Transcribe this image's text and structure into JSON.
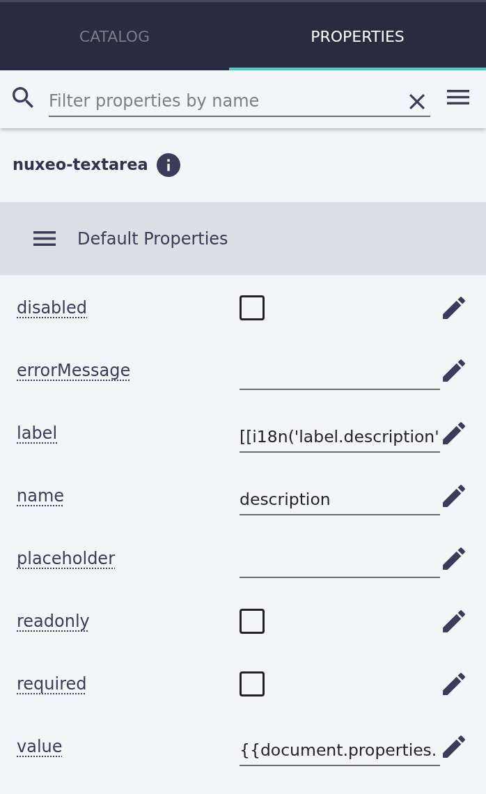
{
  "tabs": [
    {
      "label": "CATALOG",
      "selected": false
    },
    {
      "label": "PROPERTIES",
      "selected": true
    }
  ],
  "search": {
    "placeholder": "Filter properties by name"
  },
  "element": {
    "title": "nuxeo-textarea"
  },
  "section": {
    "title": "Default Properties"
  },
  "properties": [
    {
      "name": "disabled",
      "kind": "checkbox",
      "checked": false
    },
    {
      "name": "errorMessage",
      "kind": "text"
    },
    {
      "name": "label",
      "kind": "text",
      "value": "[[i18n('label.description'"
    },
    {
      "name": "name",
      "kind": "text",
      "value": "description"
    },
    {
      "name": "placeholder",
      "kind": "text"
    },
    {
      "name": "readonly",
      "kind": "checkbox",
      "checked": false
    },
    {
      "name": "required",
      "kind": "checkbox",
      "checked": false
    },
    {
      "name": "value",
      "kind": "text",
      "value": "{{document.properties."
    }
  ]
}
